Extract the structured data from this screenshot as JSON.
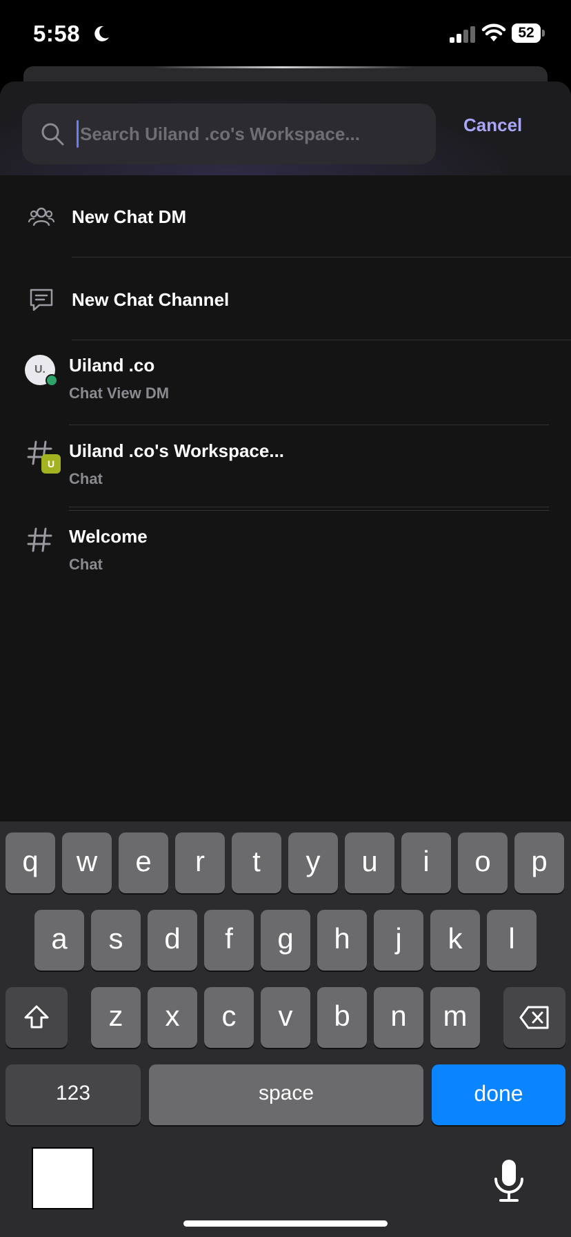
{
  "status_bar": {
    "time": "5:58",
    "battery": "52"
  },
  "search": {
    "placeholder": "Search Uiland .co's Workspace...",
    "cancel_label": "Cancel"
  },
  "actions": [
    {
      "label": "New Chat DM",
      "icon": "people-icon"
    },
    {
      "label": "New Chat Channel",
      "icon": "chat-bubble-icon"
    }
  ],
  "results": [
    {
      "title": "Uiland .co",
      "subtitle": "Chat View DM",
      "avatar_text": "U."
    },
    {
      "title": "Uiland .co's Workspace...",
      "subtitle": "Chat",
      "badge_text": "U"
    },
    {
      "title": "Welcome",
      "subtitle": "Chat"
    }
  ],
  "keyboard": {
    "row1": [
      "q",
      "w",
      "e",
      "r",
      "t",
      "y",
      "u",
      "i",
      "o",
      "p"
    ],
    "row2": [
      "a",
      "s",
      "d",
      "f",
      "g",
      "h",
      "j",
      "k",
      "l"
    ],
    "row3": [
      "z",
      "x",
      "c",
      "v",
      "b",
      "n",
      "m"
    ],
    "numbers_label": "123",
    "space_label": "space",
    "done_label": "done"
  },
  "colors": {
    "accent": "#a9a6f5",
    "done_key": "#0a84ff",
    "online": "#2fa36b",
    "workspace_badge": "#a3b31f"
  }
}
